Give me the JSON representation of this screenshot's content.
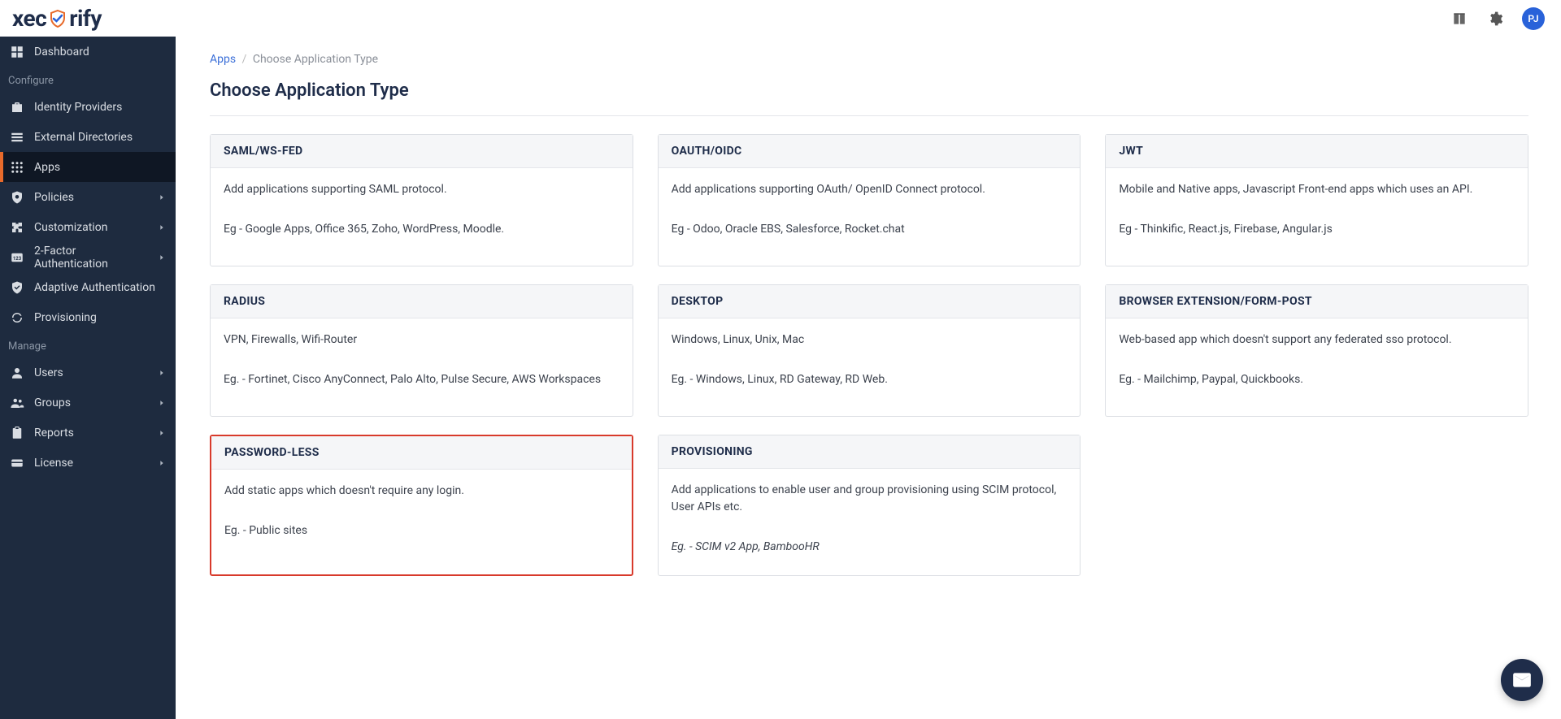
{
  "header": {
    "logo_prefix": "xec",
    "logo_suffix": "rify",
    "avatar_initials": "PJ"
  },
  "sidebar": {
    "items": [
      {
        "label": "Dashboard",
        "icon": "dashboard-icon",
        "arrow": false,
        "active": false
      },
      {
        "section": "Configure"
      },
      {
        "label": "Identity Providers",
        "icon": "briefcase-icon",
        "arrow": false,
        "active": false
      },
      {
        "label": "External Directories",
        "icon": "list-icon",
        "arrow": false,
        "active": false
      },
      {
        "label": "Apps",
        "icon": "grid-icon",
        "arrow": false,
        "active": true
      },
      {
        "label": "Policies",
        "icon": "shield-gear-icon",
        "arrow": true,
        "active": false
      },
      {
        "label": "Customization",
        "icon": "puzzle-icon",
        "arrow": true,
        "active": false
      },
      {
        "label": "2-Factor Authentication",
        "icon": "2fa-icon",
        "arrow": true,
        "active": false
      },
      {
        "label": "Adaptive Authentication",
        "icon": "shield-check-icon",
        "arrow": false,
        "active": false
      },
      {
        "label": "Provisioning",
        "icon": "sync-icon",
        "arrow": false,
        "active": false
      },
      {
        "section": "Manage"
      },
      {
        "label": "Users",
        "icon": "user-icon",
        "arrow": true,
        "active": false
      },
      {
        "label": "Groups",
        "icon": "groups-icon",
        "arrow": true,
        "active": false
      },
      {
        "label": "Reports",
        "icon": "clipboard-icon",
        "arrow": true,
        "active": false
      },
      {
        "label": "License",
        "icon": "card-icon",
        "arrow": true,
        "active": false
      }
    ]
  },
  "breadcrumb": {
    "parent": "Apps",
    "current": "Choose Application Type"
  },
  "page_title": "Choose Application Type",
  "cards": [
    {
      "title": "SAML/WS-FED",
      "desc": "Add applications supporting SAML protocol.",
      "eg": "Eg - Google Apps, Office 365, Zoho, WordPress, Moodle.",
      "highlight": false,
      "italic": false
    },
    {
      "title": "OAUTH/OIDC",
      "desc": "Add applications supporting OAuth/ OpenID Connect protocol.",
      "eg": "Eg - Odoo, Oracle EBS, Salesforce, Rocket.chat",
      "highlight": false,
      "italic": false
    },
    {
      "title": "JWT",
      "desc": "Mobile and Native apps, Javascript Front-end apps which uses an API.",
      "eg": "Eg - Thinkific, React.js, Firebase, Angular.js",
      "highlight": false,
      "italic": false
    },
    {
      "title": "RADIUS",
      "desc": "VPN, Firewalls, Wifi-Router",
      "eg": "Eg. - Fortinet, Cisco AnyConnect, Palo Alto, Pulse Secure, AWS Workspaces",
      "highlight": false,
      "italic": false
    },
    {
      "title": "DESKTOP",
      "desc": "Windows, Linux, Unix, Mac",
      "eg": "Eg. - Windows, Linux, RD Gateway, RD Web.",
      "highlight": false,
      "italic": false
    },
    {
      "title": "BROWSER EXTENSION/FORM-POST",
      "desc": "Web-based app which doesn't support any federated sso protocol.",
      "eg": "Eg. - Mailchimp, Paypal, Quickbooks.",
      "highlight": false,
      "italic": false
    },
    {
      "title": "PASSWORD-LESS",
      "desc": "Add static apps which doesn't require any login.",
      "eg": "Eg. - Public sites",
      "highlight": true,
      "italic": false
    },
    {
      "title": "PROVISIONING",
      "desc": "Add applications to enable user and group provisioning using SCIM protocol, User APIs etc.",
      "eg": "Eg. - SCIM v2 App, BambooHR",
      "highlight": false,
      "italic": true
    }
  ]
}
